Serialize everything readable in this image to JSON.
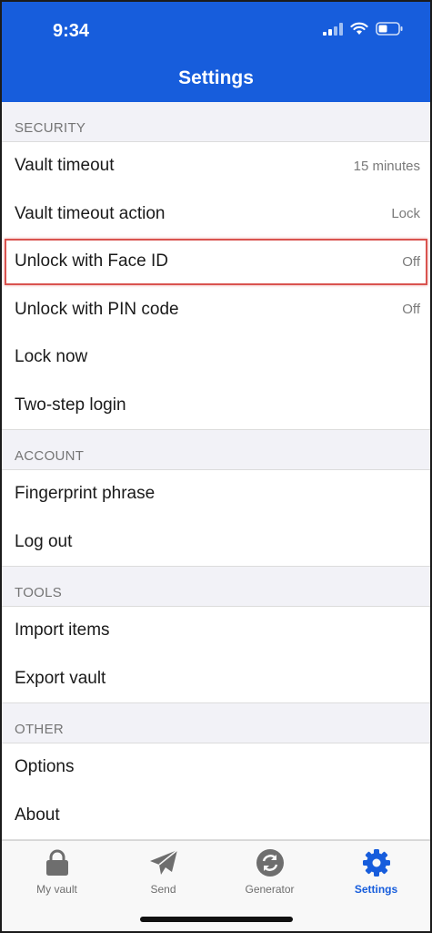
{
  "status_bar": {
    "time": "9:34"
  },
  "header": {
    "title": "Settings"
  },
  "colors": {
    "brand": "#175ddc",
    "highlight": "#d9534f"
  },
  "sections": {
    "security": {
      "title": "SECURITY",
      "items": [
        {
          "label": "Vault timeout",
          "value": "15 minutes"
        },
        {
          "label": "Vault timeout action",
          "value": "Lock"
        },
        {
          "label": "Unlock with Face ID",
          "value": "Off"
        },
        {
          "label": "Unlock with PIN code",
          "value": "Off"
        },
        {
          "label": "Lock now",
          "value": ""
        },
        {
          "label": "Two-step login",
          "value": ""
        }
      ]
    },
    "account": {
      "title": "ACCOUNT",
      "items": [
        {
          "label": "Fingerprint phrase"
        },
        {
          "label": "Log out"
        }
      ]
    },
    "tools": {
      "title": "TOOLS",
      "items": [
        {
          "label": "Import items"
        },
        {
          "label": "Export vault"
        }
      ]
    },
    "other": {
      "title": "OTHER",
      "items": [
        {
          "label": "Options"
        },
        {
          "label": "About"
        }
      ]
    }
  },
  "tabbar": {
    "tabs": [
      {
        "label": "My vault",
        "icon": "lock-icon"
      },
      {
        "label": "Send",
        "icon": "paper-plane-icon"
      },
      {
        "label": "Generator",
        "icon": "refresh-icon"
      },
      {
        "label": "Settings",
        "icon": "gear-icon",
        "active": true
      }
    ]
  }
}
